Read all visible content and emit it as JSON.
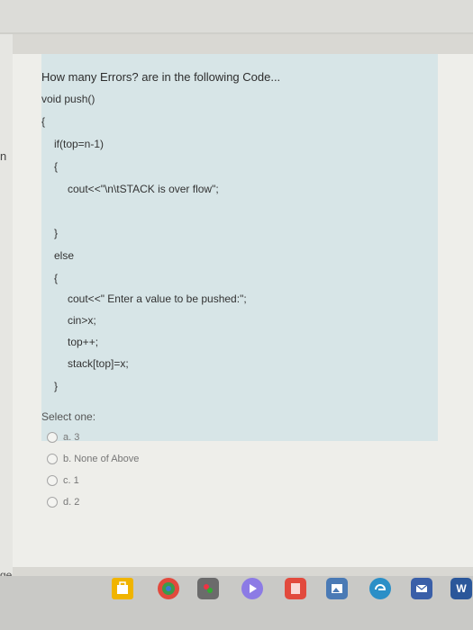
{
  "question": {
    "title": "How many Errors? are in the following Code...",
    "code_lines": [
      "void push()",
      "{",
      "if(top=n-1)",
      "{",
      "cout<<\"\\n\\tSTACK is over flow\";",
      "}",
      "else",
      "{",
      "cout<<\" Enter a value to be pushed:\";",
      "cin>x;",
      "top++;",
      "stack[top]=x;",
      "}"
    ]
  },
  "answers": {
    "select_label": "Select one:",
    "options": [
      "a. 3",
      "b. None of Above",
      "c. 1",
      "d. 2"
    ]
  },
  "edge_text": {
    "left_bottom": "ge",
    "left_top": "n"
  },
  "taskbar": {
    "icons": [
      "store-icon",
      "chrome-icon",
      "paint-icon",
      "media-icon",
      "office-icon",
      "photos-icon",
      "edge-icon",
      "mail-icon",
      "word-icon"
    ],
    "word_letter": "W"
  },
  "colors": {
    "question_bg": "#d7e5e7",
    "page_bg": "#eeeeea",
    "taskbar_bg": "#c9c9c6"
  }
}
